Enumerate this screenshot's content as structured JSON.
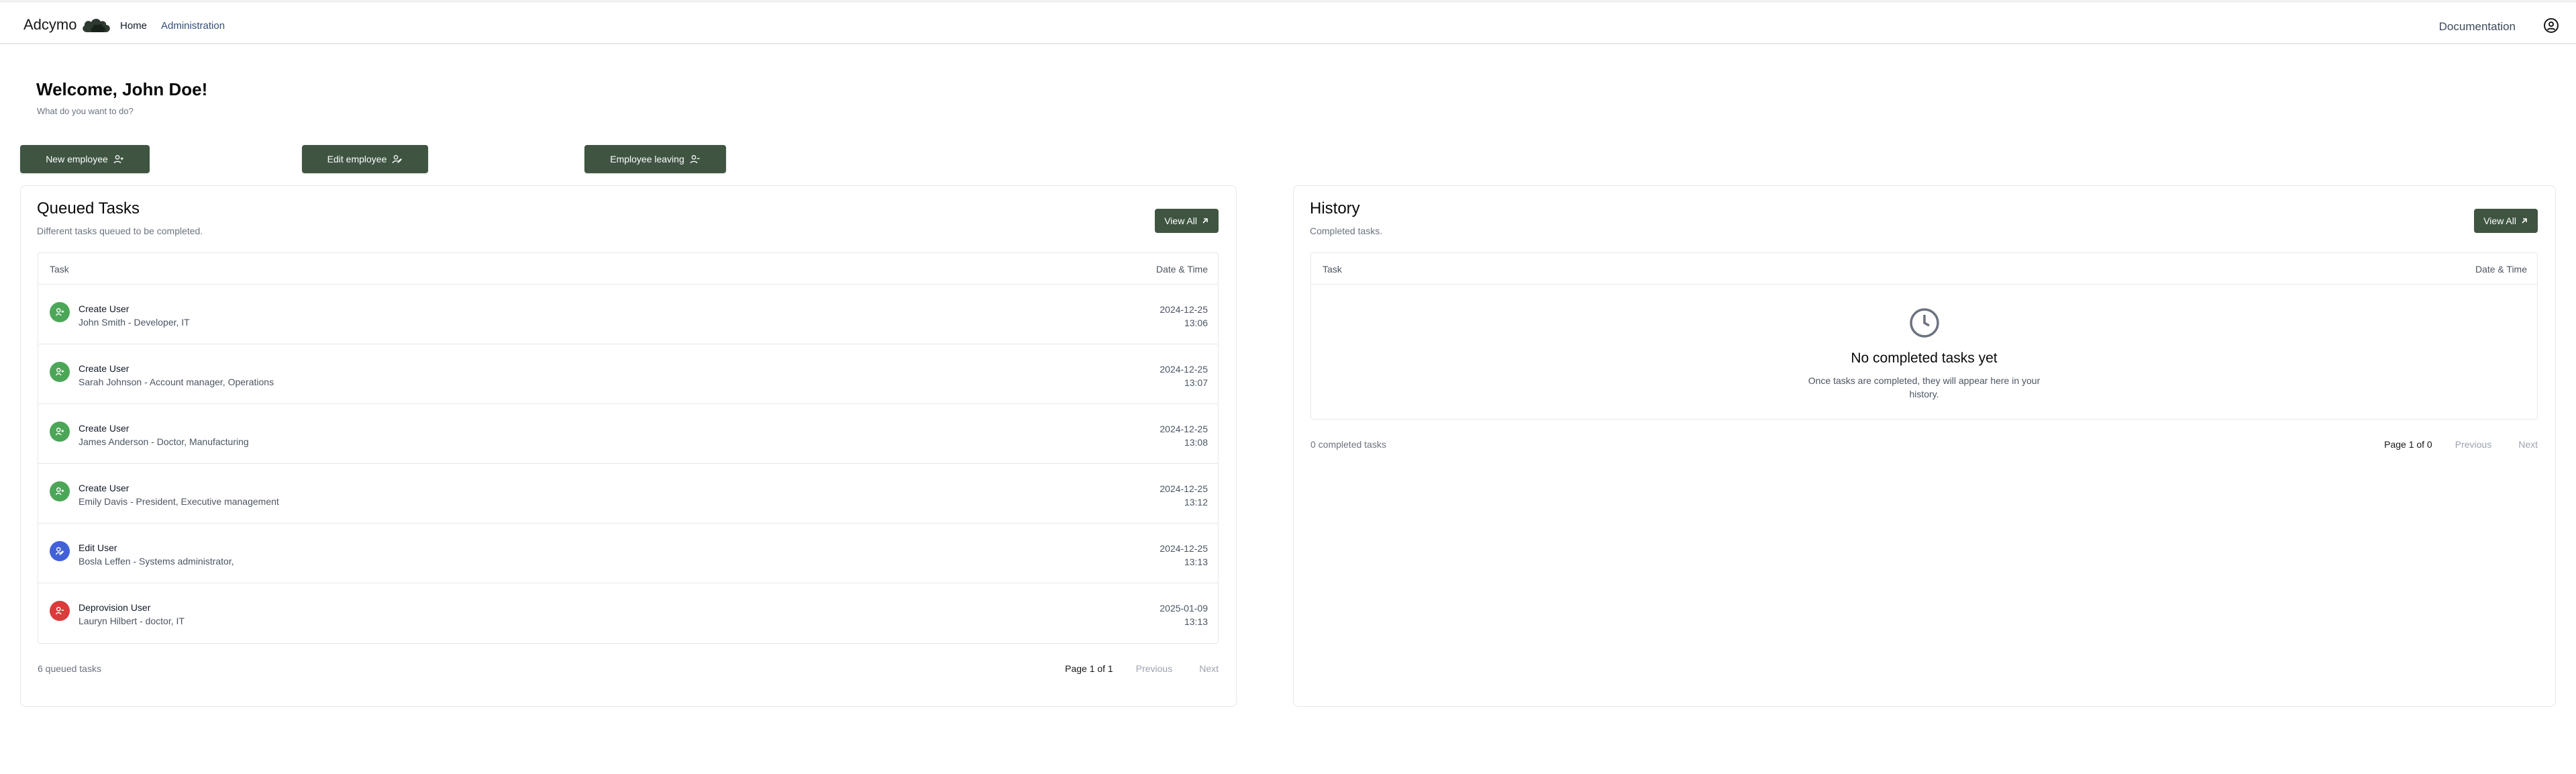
{
  "nav": {
    "brand": "Adcymo",
    "links": [
      "Home",
      "Administration"
    ],
    "docs": "Documentation"
  },
  "welcome": {
    "title": "Welcome, John Doe!",
    "subtitle": "What do you want to do?"
  },
  "actions": [
    "New employee",
    "Edit employee",
    "Employee leaving"
  ],
  "queued": {
    "title": "Queued Tasks",
    "subtitle": "Different tasks queued to be completed.",
    "view_all": "View All",
    "columns": {
      "task": "Task",
      "date": "Date & Time"
    },
    "rows": [
      {
        "title": "Create User",
        "desc": "John Smith - Developer, IT",
        "date": "2024-12-25",
        "time": "13:06",
        "kind": "create",
        "color": "#4ca658"
      },
      {
        "title": "Create User",
        "desc": "Sarah Johnson - Account manager, Operations",
        "date": "2024-12-25",
        "time": "13:07",
        "kind": "create",
        "color": "#4ca658"
      },
      {
        "title": "Create User",
        "desc": "James Anderson - Doctor, Manufacturing",
        "date": "2024-12-25",
        "time": "13:08",
        "kind": "create",
        "color": "#4ca658"
      },
      {
        "title": "Create User",
        "desc": "Emily Davis - President, Executive management",
        "date": "2024-12-25",
        "time": "13:12",
        "kind": "create",
        "color": "#4ca658"
      },
      {
        "title": "Edit User",
        "desc": "Bosla Leffen - Systems administrator,",
        "date": "2024-12-25",
        "time": "13:13",
        "kind": "edit",
        "color": "#4261d9"
      },
      {
        "title": "Deprovision User",
        "desc": "Lauryn Hilbert - doctor, IT",
        "date": "2025-01-09",
        "time": "13:13",
        "kind": "deprovision",
        "color": "#dc3b3b"
      }
    ],
    "count": "6 queued tasks",
    "page_info": "Page 1 of 1",
    "prev": "Previous",
    "next": "Next"
  },
  "history": {
    "title": "History",
    "subtitle": "Completed tasks.",
    "view_all": "View All",
    "columns": {
      "task": "Task",
      "date": "Date & Time"
    },
    "empty_title": "No completed tasks yet",
    "empty_text": "Once tasks are completed, they will appear here in your history.",
    "count": "0 completed tasks",
    "page_info": "Page 1 of 0",
    "prev": "Previous",
    "next": "Next"
  },
  "colors": {
    "accent": "#3f5542",
    "create": "#4ca658",
    "edit": "#4261d9",
    "deprovision": "#dc3b3b"
  }
}
